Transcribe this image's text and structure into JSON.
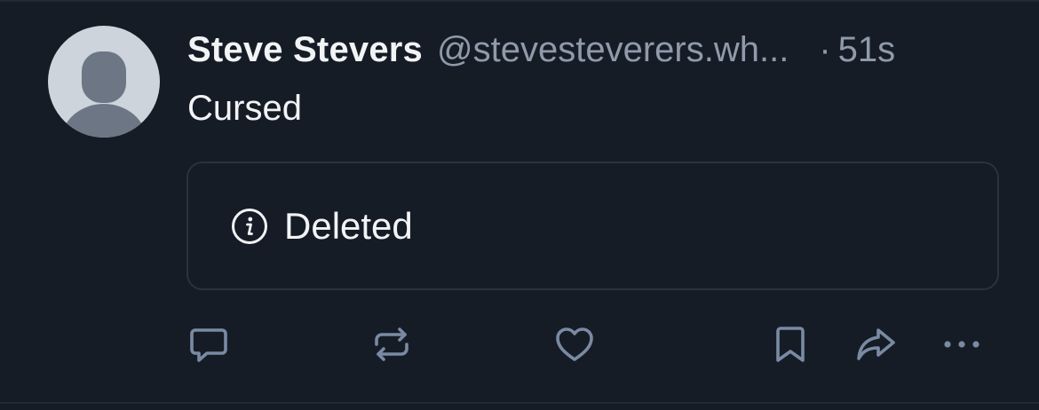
{
  "post": {
    "author": {
      "display_name": "Steve Stevers",
      "handle": "@stevesteverers.wh..."
    },
    "separator": "·",
    "timestamp": "51s",
    "text": "Cursed",
    "embed": {
      "icon": "info-circle-icon",
      "label": "Deleted"
    }
  },
  "actions": [
    {
      "name": "reply",
      "icon": "chat-bubble-icon"
    },
    {
      "name": "repost",
      "icon": "repost-icon"
    },
    {
      "name": "like",
      "icon": "heart-icon"
    },
    {
      "name": "bookmark",
      "icon": "bookmark-icon"
    },
    {
      "name": "share",
      "icon": "share-arrow-icon"
    },
    {
      "name": "more",
      "icon": "more-dots-icon"
    }
  ],
  "colors": {
    "background": "#161c26",
    "primary_text": "#f1f3f5",
    "secondary_text": "#8f9aaa",
    "icon": "#7a8aa3",
    "border": "#2a3240",
    "avatar_bg": "#cdd4dc",
    "avatar_fg": "#6c7685"
  }
}
